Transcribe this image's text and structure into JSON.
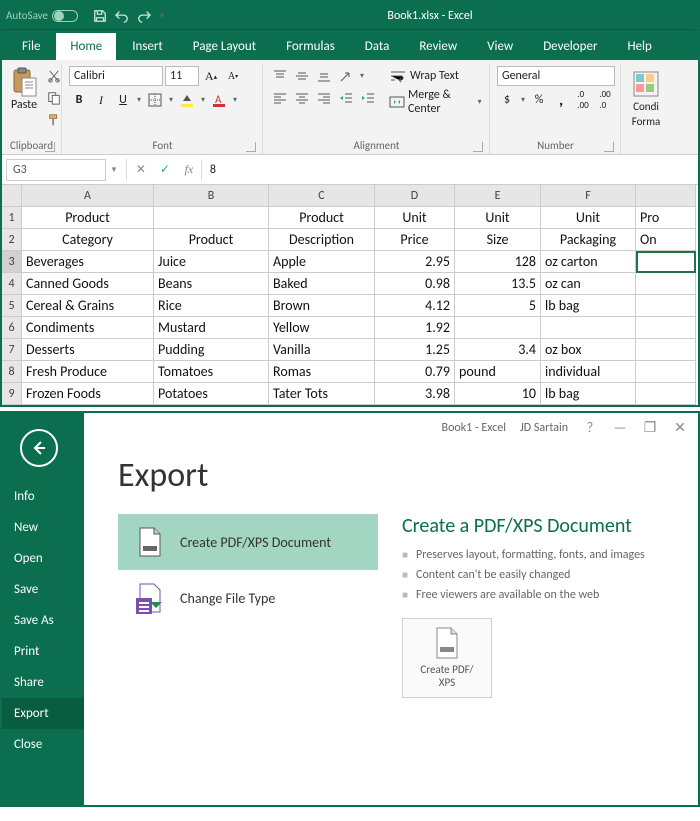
{
  "titlebar": {
    "autosave": "AutoSave",
    "title": "Book1.xlsx - Excel"
  },
  "ribbon_tabs": [
    "File",
    "Home",
    "Insert",
    "Page Layout",
    "Formulas",
    "Data",
    "Review",
    "View",
    "Developer",
    "Help"
  ],
  "ribbon": {
    "clipboard": {
      "paste": "Paste",
      "label": "Clipboard"
    },
    "font": {
      "name": "Calibri",
      "size": "11",
      "label": "Font",
      "bold": "B",
      "italic": "I",
      "underline": "U"
    },
    "alignment": {
      "wrap": "Wrap Text",
      "merge": "Merge & Center",
      "label": "Alignment"
    },
    "number": {
      "format": "General",
      "label": "Number",
      "currency": "$",
      "percent": "%",
      "comma": ","
    },
    "cond": {
      "top": "Condi",
      "bottom": "Forma"
    }
  },
  "formula_bar": {
    "name_box": "G3",
    "value": "8"
  },
  "sheet": {
    "cols": [
      "A",
      "B",
      "C",
      "D",
      "E",
      "F"
    ],
    "partial_col": "",
    "header1": [
      "Product",
      "",
      "Product",
      "Unit",
      "Unit",
      "Unit",
      "Pro"
    ],
    "header2": [
      "Category",
      "Product",
      "Description",
      "Price",
      "Size",
      "Packaging",
      "On"
    ],
    "rows": [
      {
        "n": 3,
        "cells": [
          "Beverages",
          "Juice",
          "Apple",
          "2.95",
          "128",
          "oz carton",
          ""
        ]
      },
      {
        "n": 4,
        "cells": [
          "Canned Goods",
          "Beans",
          "Baked",
          "0.98",
          "13.5",
          "oz can",
          ""
        ]
      },
      {
        "n": 5,
        "cells": [
          "Cereal & Grains",
          "Rice",
          "Brown",
          "4.12",
          "5",
          "lb bag",
          ""
        ]
      },
      {
        "n": 6,
        "cells": [
          "Condiments",
          "Mustard",
          "Yellow",
          "1.92",
          "",
          "",
          ""
        ]
      },
      {
        "n": 7,
        "cells": [
          "Desserts",
          "Pudding",
          "Vanilla",
          "1.25",
          "3.4",
          "oz box",
          ""
        ]
      },
      {
        "n": 8,
        "cells": [
          "Fresh Produce",
          "Tomatoes",
          "Romas",
          "0.79",
          "pound",
          "individual",
          ""
        ]
      },
      {
        "n": 9,
        "cells": [
          "Frozen Foods",
          "Potatoes",
          "Tater Tots",
          "3.98",
          "10",
          "lb bag",
          ""
        ]
      }
    ]
  },
  "backstage": {
    "top": {
      "doc": "Book1 - Excel",
      "user": "JD Sartain"
    },
    "nav": [
      "Info",
      "New",
      "Open",
      "Save",
      "Save As",
      "Print",
      "Share",
      "Export",
      "Close"
    ],
    "title": "Export",
    "options": [
      {
        "label": "Create PDF/XPS Document",
        "selected": true
      },
      {
        "label": "Change File Type",
        "selected": false
      }
    ],
    "panel": {
      "heading": "Create a PDF/XPS Document",
      "bullets": [
        "Preserves layout, formatting, fonts, and images",
        "Content can't be easily changed",
        "Free viewers are available on the web"
      ],
      "button": "Create PDF/ XPS"
    }
  }
}
